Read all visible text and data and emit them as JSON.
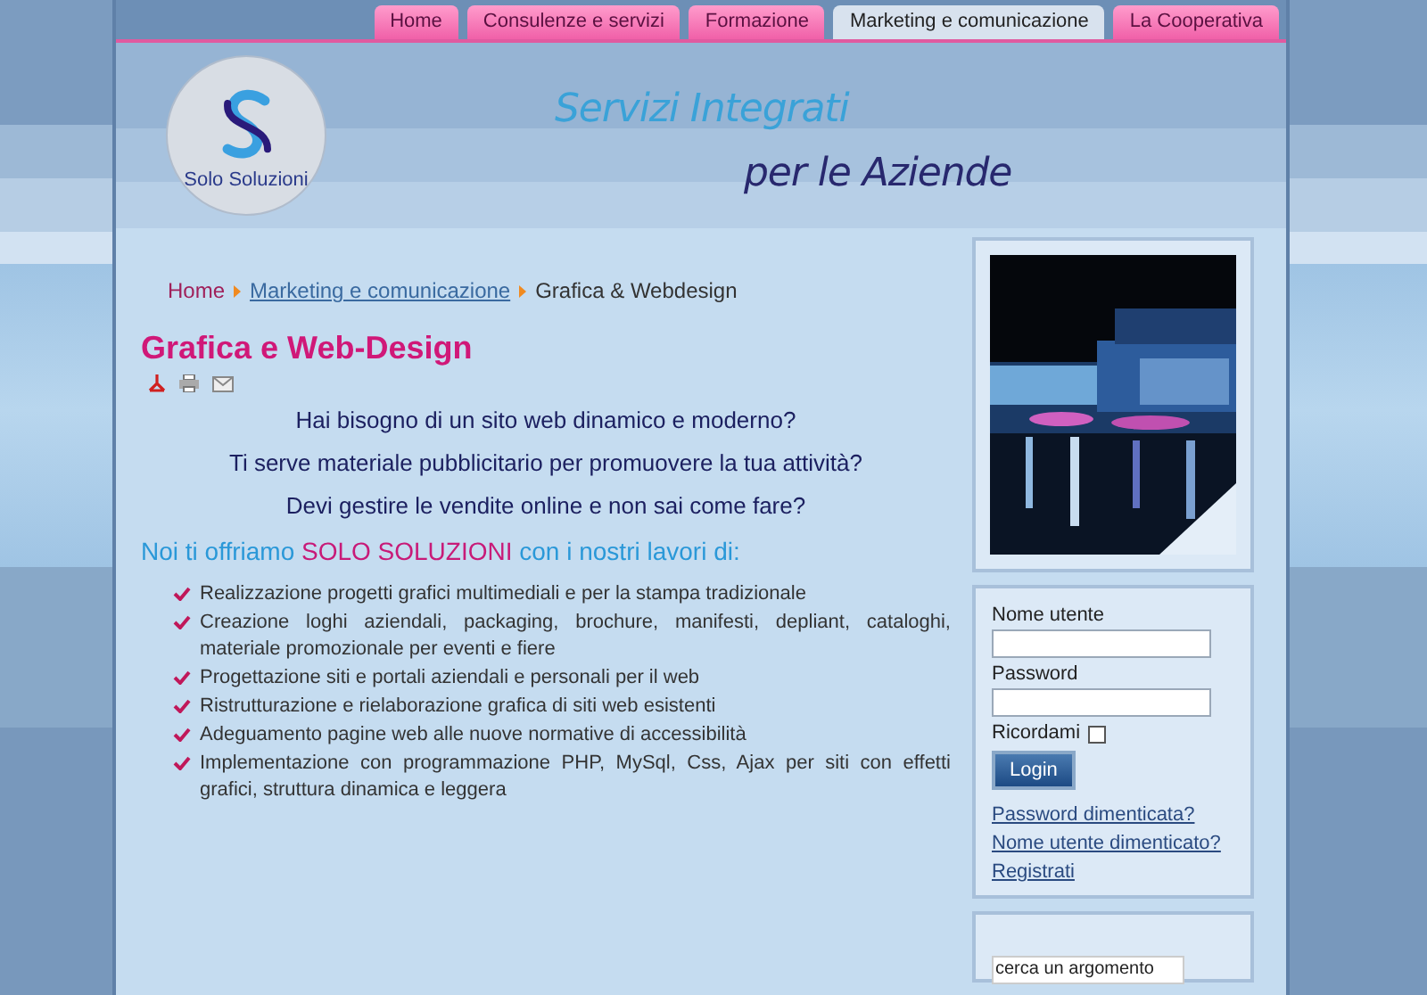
{
  "nav": {
    "tabs": [
      {
        "label": "Home",
        "selected": false
      },
      {
        "label": "Consulenze e servizi",
        "selected": false
      },
      {
        "label": "Formazione",
        "selected": false
      },
      {
        "label": "Marketing e comunicazione",
        "selected": true
      },
      {
        "label": "La Cooperativa",
        "selected": false
      }
    ]
  },
  "logo": {
    "text": "Solo Soluzioni"
  },
  "banner": {
    "tagline": "Servizi Integrati",
    "subline": "per le Aziende"
  },
  "breadcrumb": [
    {
      "label": "Home",
      "kind": "home"
    },
    {
      "label": "Marketing e comunicazione",
      "kind": "link"
    },
    {
      "label": "Grafica & Webdesign",
      "kind": "current"
    }
  ],
  "article": {
    "title": "Grafica e Web-Design",
    "questions": [
      "Hai bisogno di un sito web dinamico e moderno?",
      "Ti serve materiale pubblicitario per promuovere la tua attività?",
      "Devi gestire le vendite online e non sai come fare?"
    ],
    "intro": {
      "before": "Noi ti offriamo ",
      "highlight": "SOLO SOLUZIONI",
      "after": " con i nostri lavori di:"
    },
    "features": [
      "Realizzazione progetti grafici multimediali e per la stampa tradizionale",
      "Creazione loghi aziendali, packaging, brochure, manifesti, depliant, cataloghi, materiale promozionale per eventi e fiere",
      "Progettazione siti e portali aziendali e personali per il web",
      "Ristrutturazione e rielaborazione grafica di siti web esistenti",
      "Adeguamento pagine web alle nuove normative di accessibilità",
      "Implementazione con programmazione PHP, MySql, Css, Ajax per siti con effetti grafici, struttura dinamica e leggera"
    ]
  },
  "login": {
    "fields": [
      {
        "label": "Nome utente"
      },
      {
        "label": "Password"
      }
    ],
    "remember": {
      "label": "Ricordami",
      "checked": false
    },
    "button": "Login",
    "links": [
      "Password dimenticata?",
      "Nome utente dimenticato?",
      "Registrati"
    ]
  },
  "search": {
    "value": "cerca un argomento"
  }
}
